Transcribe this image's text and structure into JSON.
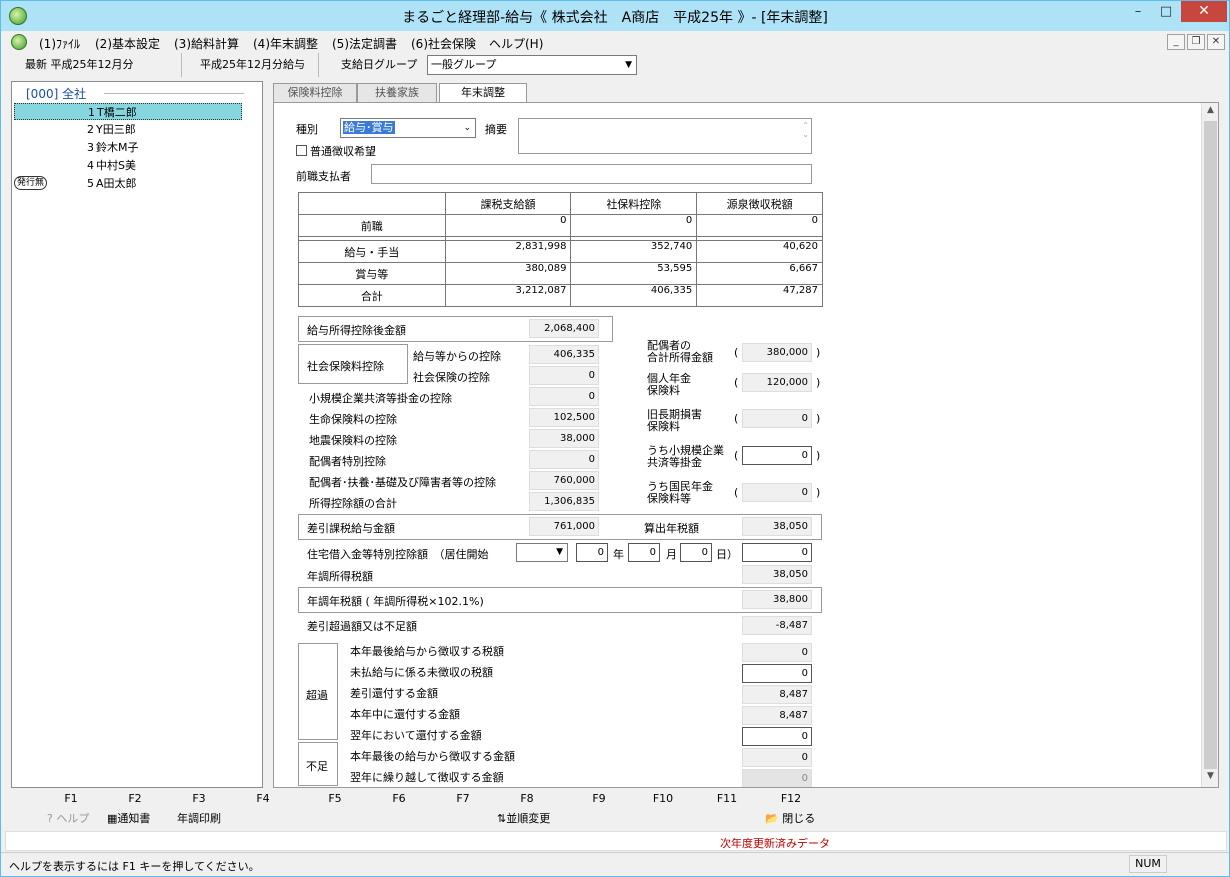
{
  "window": {
    "title": "まるごと経理部-給与《 株式会社　A商店　平成25年 》- [年末調整]"
  },
  "menu": [
    "(1)ﾌｧｲﾙ",
    "(2)基本設定",
    "(3)給料計算",
    "(4)年末調整",
    "(5)法定調書",
    "(6)社会保険",
    "ヘルプ(H)"
  ],
  "info": {
    "latest": "最新 平成25年12月分",
    "period": "平成25年12月分給与",
    "group_label": "支給日グループ",
    "group_value": "一般グループ"
  },
  "tree": {
    "root": "[000] 全社",
    "employees": [
      {
        "num": "1",
        "name": "T橋二郎",
        "selected": true
      },
      {
        "num": "2",
        "name": "Y田三郎"
      },
      {
        "num": "3",
        "name": "鈴木M子"
      },
      {
        "num": "4",
        "name": "中村S美"
      },
      {
        "num": "5",
        "name": "A田太郎",
        "badge": "発行無"
      }
    ]
  },
  "tabs": [
    "保険料控除",
    "扶養家族",
    "年末調整"
  ],
  "form": {
    "type_label": "種別",
    "type_value": "給与･賞与",
    "memo_label": "摘要",
    "checkbox_label": "普通徴収希望",
    "prev_payer_label": "前職支払者",
    "table": {
      "headers": [
        "課税支給額",
        "社保料控除",
        "源泉徴収税額"
      ],
      "rows": [
        {
          "label": "前職",
          "values": [
            "0",
            "0",
            "0"
          ]
        },
        {
          "label": "給与・手当",
          "values": [
            "2,831,998",
            "352,740",
            "40,620"
          ]
        },
        {
          "label": "賞与等",
          "values": [
            "380,089",
            "53,595",
            "6,667"
          ]
        },
        {
          "label": "合計",
          "values": [
            "3,212,087",
            "406,335",
            "47,287"
          ]
        }
      ]
    },
    "after_deduction": {
      "label": "給与所得控除後金額",
      "value": "2,068,400"
    },
    "social": {
      "group_label": "社会保険料控除",
      "from_salary_label": "給与等からの控除",
      "from_salary": "406,335",
      "social_label": "社会保険の控除",
      "social": "0"
    },
    "deductions": [
      {
        "label": "小規模企業共済等掛金の控除",
        "value": "0"
      },
      {
        "label": "生命保険料の控除",
        "value": "102,500"
      },
      {
        "label": "地震保険料の控除",
        "value": "38,000"
      },
      {
        "label": "配偶者特別控除",
        "value": "0"
      },
      {
        "label": "配偶者･扶養･基礎及び障害者等の控除",
        "value": "760,000"
      },
      {
        "label": "所得控除額の合計",
        "value": "1,306,835"
      }
    ],
    "right": [
      {
        "l1": "配偶者の",
        "l2": "合計所得金額",
        "value": "380,000"
      },
      {
        "l1": "個人年金",
        "l2": "保険料",
        "value": "120,000"
      },
      {
        "l1": "旧長期損害",
        "l2": "保険料",
        "value": "0"
      },
      {
        "l1": "うち小規模企業",
        "l2": "共済等掛金",
        "value": "0"
      },
      {
        "l1": "うち国民年金",
        "l2": "保険料等",
        "value": "0"
      }
    ],
    "taxable": {
      "label": "差引課税給与金額",
      "value": "761,000",
      "calc_label": "算出年税額",
      "calc_value": "38,050"
    },
    "housing": {
      "label": "住宅借入金等特別控除額　（居住開始",
      "year": "0",
      "year_label": "年",
      "month": "0",
      "month_label": "月",
      "day": "0",
      "day_label": "日）",
      "value": "0"
    },
    "annual_tax": {
      "label": "年調所得税額",
      "value": "38,050"
    },
    "annual_tax2": {
      "label": "年調年税額 ( 年調所得税×102.1%)",
      "value": "38,800"
    },
    "diff": {
      "label": "差引超過額又は不足額",
      "value": "-8,487"
    },
    "excess": {
      "label": "超過",
      "items": [
        {
          "label": "本年最後給与から徴収する税額",
          "value": "0"
        },
        {
          "label": "未払給与に係る未徴収の税額",
          "value": "0"
        },
        {
          "label": "差引還付する金額",
          "value": "8,487"
        },
        {
          "label": "本年中に還付する金額",
          "value": "8,487"
        },
        {
          "label": "翌年において還付する金額",
          "value": "0"
        }
      ]
    },
    "shortage": {
      "label": "不足",
      "items": [
        {
          "label": "本年最後の給与から徴収する金額",
          "value": "0"
        },
        {
          "label": "翌年に繰り越して徴収する金額",
          "value": "0"
        }
      ]
    }
  },
  "fkeys": {
    "keys": [
      "F1",
      "F2",
      "F3",
      "F4",
      "F5",
      "F6",
      "F7",
      "F8",
      "F9",
      "F10",
      "F11",
      "F12"
    ],
    "help": "ヘルプ",
    "notice": "通知書",
    "print": "年調印刷",
    "sort": "並順変更",
    "close": "閉じる"
  },
  "notice": "次年度更新済みデータ",
  "status": {
    "text": "ヘルプを表示するには F1 キーを押してください。",
    "num": "NUM"
  }
}
